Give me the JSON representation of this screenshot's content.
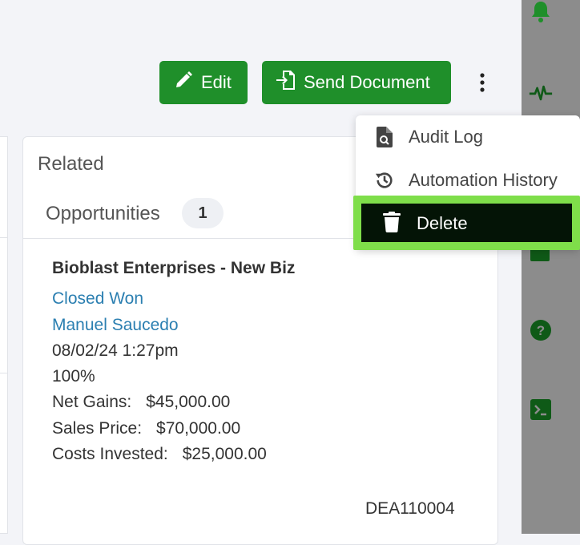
{
  "toolbar": {
    "edit_label": "Edit",
    "send_label": "Send Document"
  },
  "menu": {
    "items": [
      {
        "label": "Audit Log",
        "icon": "file-search-icon"
      },
      {
        "label": "Automation History",
        "icon": "history-icon"
      },
      {
        "label": "Delete",
        "icon": "trash-icon"
      }
    ]
  },
  "related": {
    "title": "Related",
    "tab_label": "Opportunities",
    "tab_count": "1",
    "opportunity": {
      "name": "Bioblast Enterprises - New Biz",
      "stage": "Closed Won",
      "owner": "Manuel Saucedo",
      "datetime": "08/02/24 1:27pm",
      "probability": "100%",
      "fields": [
        {
          "label": "Net Gains:",
          "value": "$45,000.00"
        },
        {
          "label": "Sales Price:",
          "value": "$70,000.00"
        },
        {
          "label": "Costs Invested:",
          "value": "$25,000.00"
        }
      ],
      "record_id": "DEA110004"
    }
  },
  "rail": {
    "icons": [
      "bell-icon",
      "activity-icon",
      "help-icon",
      "terminal-icon"
    ]
  },
  "colors": {
    "primary_green": "#1f8f2a",
    "link_blue": "#2b7fb1",
    "highlight_green": "#7fde4a"
  }
}
